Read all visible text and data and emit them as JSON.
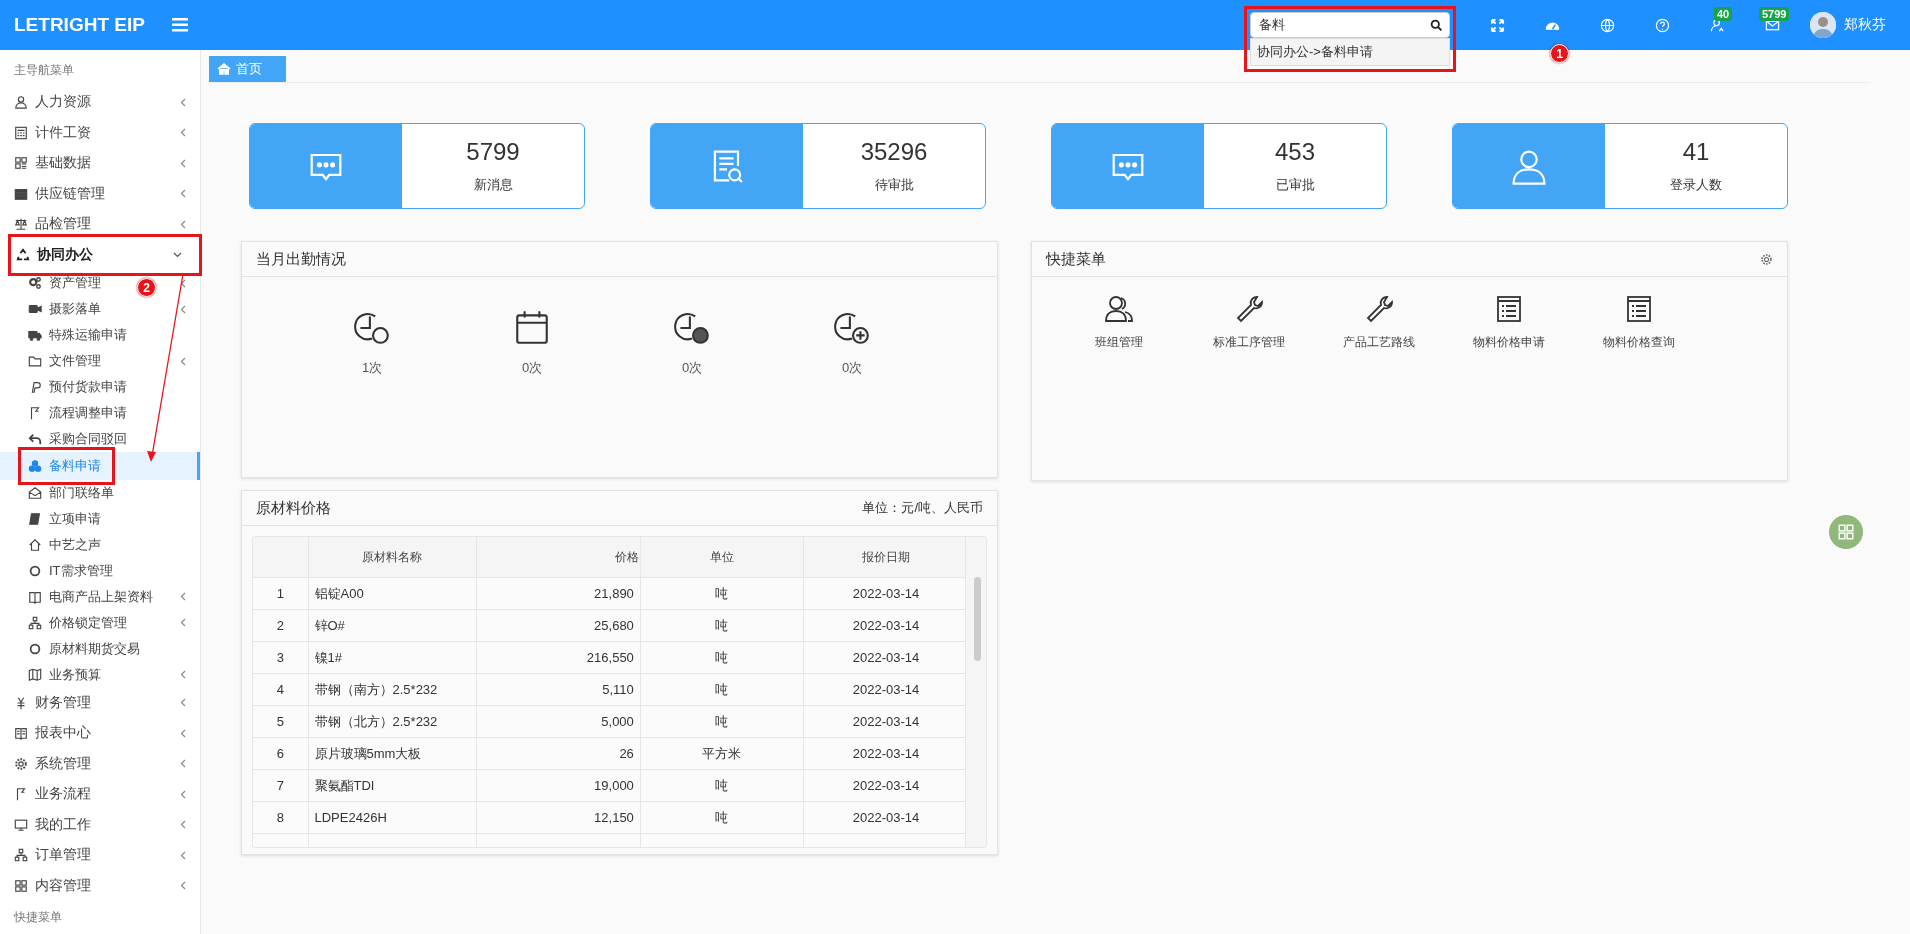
{
  "header": {
    "logo": "LETRIGHT EIP",
    "search": {
      "value": "备料",
      "suggestion": "协同办公->备料申请",
      "highlighted": true
    },
    "badges": [
      {
        "count": "40"
      },
      {
        "count": "5799"
      }
    ],
    "user": "郑秋芬"
  },
  "sidebar": {
    "title": "主导航菜单",
    "footer": "快捷菜单",
    "items": [
      {
        "label": "人力资源",
        "kind": "folder",
        "expanded": false,
        "highlighted": false
      },
      {
        "label": "计件工资",
        "kind": "folder",
        "expanded": false,
        "highlighted": false
      },
      {
        "label": "基础数据",
        "kind": "folder",
        "expanded": false,
        "highlighted": false
      },
      {
        "label": "供应链管理",
        "kind": "folder",
        "expanded": false,
        "highlighted": false
      },
      {
        "label": "品检管理",
        "kind": "folder",
        "expanded": false,
        "highlighted": false
      },
      {
        "label": "协同办公",
        "kind": "folder",
        "expanded": true,
        "highlighted": true,
        "children": [
          {
            "label": "资产管理",
            "kind": "folder",
            "selected": false,
            "highlighted": false
          },
          {
            "label": "摄影落单",
            "kind": "folder",
            "selected": false,
            "highlighted": false
          },
          {
            "label": "特殊运输申请",
            "kind": "page",
            "selected": false,
            "highlighted": false
          },
          {
            "label": "文件管理",
            "kind": "folder",
            "selected": false,
            "highlighted": false
          },
          {
            "label": "预付货款申请",
            "kind": "page",
            "selected": false,
            "highlighted": false
          },
          {
            "label": "流程调整申请",
            "kind": "page",
            "selected": false,
            "highlighted": false
          },
          {
            "label": "采购合同驳回",
            "kind": "page",
            "selected": false,
            "highlighted": false
          },
          {
            "label": "备料申请",
            "kind": "page",
            "selected": true,
            "highlighted": true
          },
          {
            "label": "部门联络单",
            "kind": "page",
            "selected": false,
            "highlighted": false
          },
          {
            "label": "立项申请",
            "kind": "page",
            "selected": false,
            "highlighted": false
          },
          {
            "label": "中艺之声",
            "kind": "page",
            "selected": false,
            "highlighted": false
          },
          {
            "label": "IT需求管理",
            "kind": "page",
            "selected": false,
            "highlighted": false
          },
          {
            "label": "电商产品上架资料",
            "kind": "folder",
            "selected": false,
            "highlighted": false
          },
          {
            "label": "价格锁定管理",
            "kind": "folder",
            "selected": false,
            "highlighted": false
          },
          {
            "label": "原材料期货交易",
            "kind": "page",
            "selected": false,
            "highlighted": false
          },
          {
            "label": "业务预算",
            "kind": "folder",
            "selected": false,
            "highlighted": false
          }
        ]
      },
      {
        "label": "财务管理",
        "kind": "folder",
        "expanded": false,
        "highlighted": false
      },
      {
        "label": "报表中心",
        "kind": "folder",
        "expanded": false,
        "highlighted": false
      },
      {
        "label": "系统管理",
        "kind": "folder",
        "expanded": false,
        "highlighted": false
      },
      {
        "label": "业务流程",
        "kind": "folder",
        "expanded": false,
        "highlighted": false
      },
      {
        "label": "我的工作",
        "kind": "folder",
        "expanded": false,
        "highlighted": false
      },
      {
        "label": "订单管理",
        "kind": "folder",
        "expanded": false,
        "highlighted": false
      },
      {
        "label": "内容管理",
        "kind": "folder",
        "expanded": false,
        "highlighted": false
      }
    ]
  },
  "tabs": [
    {
      "label": "首页",
      "selected": true
    }
  ],
  "stats": [
    {
      "value": "5799",
      "label": "新消息"
    },
    {
      "value": "35296",
      "label": "待审批"
    },
    {
      "value": "453",
      "label": "已审批"
    },
    {
      "value": "41",
      "label": "登录人数"
    }
  ],
  "attendance": {
    "title": "当月出勤情况",
    "items": [
      {
        "count": "1次"
      },
      {
        "count": "0次"
      },
      {
        "count": "0次"
      },
      {
        "count": "0次"
      }
    ]
  },
  "quick_menu": {
    "title": "快捷菜单",
    "items": [
      {
        "label": "班组管理"
      },
      {
        "label": "标准工序管理"
      },
      {
        "label": "产品工艺路线"
      },
      {
        "label": "物料价格申请"
      },
      {
        "label": "物料价格查询"
      }
    ]
  },
  "prices": {
    "title": "原材料价格",
    "unit_note": "单位：元/吨、人民币",
    "columns": [
      "",
      "原材料名称",
      "价格",
      "单位",
      "报价日期"
    ],
    "rows": [
      [
        "1",
        "铝锭A00",
        "21,890",
        "吨",
        "2022-03-14"
      ],
      [
        "2",
        "锌O#",
        "25,680",
        "吨",
        "2022-03-14"
      ],
      [
        "3",
        "镍1#",
        "216,550",
        "吨",
        "2022-03-14"
      ],
      [
        "4",
        "带钢（南方）2.5*232",
        "5,110",
        "吨",
        "2022-03-14"
      ],
      [
        "5",
        "带钢（北方）2.5*232",
        "5,000",
        "吨",
        "2022-03-14"
      ],
      [
        "6",
        "原片玻璃5mm大板",
        "26",
        "平方米",
        "2022-03-14"
      ],
      [
        "7",
        "聚氨酯TDI",
        "19,000",
        "吨",
        "2022-03-14"
      ],
      [
        "8",
        "LDPE2426H",
        "12,150",
        "吨",
        "2022-03-14"
      ]
    ]
  },
  "annotations": [
    {
      "label": "1"
    },
    {
      "label": "2"
    }
  ]
}
